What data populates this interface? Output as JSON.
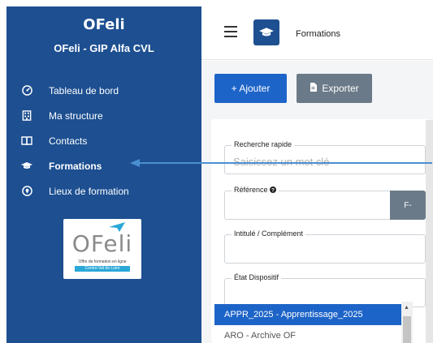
{
  "sidebar": {
    "app_title": "OFeli",
    "app_subtitle": "OFeli - GIP Alfa CVL",
    "items": [
      {
        "label": "Tableau de bord",
        "icon": "dashboard-icon",
        "active": false
      },
      {
        "label": "Ma structure",
        "icon": "building-icon",
        "active": false
      },
      {
        "label": "Contacts",
        "icon": "address-book-icon",
        "active": false
      },
      {
        "label": "Formations",
        "icon": "graduation-cap-icon",
        "active": true
      },
      {
        "label": "Lieux de formation",
        "icon": "location-pin-icon",
        "active": false
      }
    ],
    "logo": {
      "text": "OFeli",
      "tagline": "Offre de formation en ligne",
      "band": "Centre-Val de Loire"
    }
  },
  "header": {
    "title": "Formations",
    "page_icon": "graduation-cap-icon"
  },
  "toolbar": {
    "add_label": "+ Ajouter",
    "export_label": "Exporter"
  },
  "filters": {
    "quick_search": {
      "label": "Recherche rapide",
      "placeholder": "Saisissez un mot clé"
    },
    "reference": {
      "label": "Référence",
      "button": "F-"
    },
    "title": {
      "label": "Intitulé / Complément"
    },
    "status": {
      "label": "État Dispositif",
      "options": [
        "APPR_2025 - Apprentissage_2025",
        "ARO - Archive OF"
      ],
      "selected": "APPR_2025 - Apprentissage_2025"
    }
  },
  "colors": {
    "sidebar": "#1d4f91",
    "primary": "#1d64c8",
    "secondary": "#6b7a88",
    "annotation_arrow": "#4a8fd0"
  }
}
